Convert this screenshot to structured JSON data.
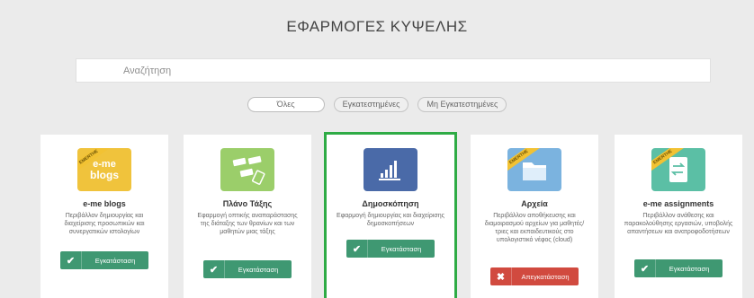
{
  "page": {
    "title": "ΕΦΑΡΜΟΓΕΣ ΚΥΨΕΛΗΣ"
  },
  "search": {
    "placeholder": "Αναζήτηση"
  },
  "filters": {
    "all": "Όλες",
    "installed": "Εγκατεστημένες",
    "not_installed": "Μη Εγκατεστημένες"
  },
  "apps": [
    {
      "name": "e-me blogs",
      "badge": "EMERTHE",
      "logo_lines": [
        "e-me",
        "blogs"
      ],
      "description": "Περιβάλλον δημιουργίας και διαχείρισης προσωπικών και συνεργατικών ιστολογίων",
      "action": "Εγκατάσταση",
      "action_icon": "check",
      "icon_color": "#f0c33c"
    },
    {
      "name": "Πλάνο Τάξης",
      "description": "Εφαρμογή οπτικής αναπαράστασης της διάταξης των θρανίων και των μαθητών μιας τάξης",
      "action": "Εγκατάσταση",
      "action_icon": "check",
      "icon_color": "#9bce6a"
    },
    {
      "name": "Δημοσκόπηση",
      "description": "Εφαρμογή δημιουργίας και διαχείρισης δημοσκοπήσεων",
      "action": "Εγκατάσταση",
      "action_icon": "check",
      "icon_color": "#4a6aa8"
    },
    {
      "name": "Αρχεία",
      "badge": "EMERTHE",
      "description": "Περιβάλλον αποθήκευσης και διαμοιρασμού αρχείων για μαθητές/τριες και εκπαιδευτικούς στο υπολογιστικό νέφος (cloud)",
      "action": "Απεγκατάσταση",
      "action_icon": "cross",
      "icon_color": "#7bb3df"
    },
    {
      "name": "e-me assignments",
      "badge": "EMERTHE",
      "description": "Περιβάλλον ανάθεσης και παρακολούθησης εργασιών, υποβολής απαντήσεων και ανατροφοδοτήσεων",
      "action": "Εγκατάσταση",
      "action_icon": "check",
      "icon_color": "#5bbfa5"
    }
  ],
  "selected_app": "Δημοσκόπηση",
  "colors": {
    "install": "#3f9872",
    "uninstall": "#d14a3f",
    "selected_outline": "#2eab45"
  }
}
